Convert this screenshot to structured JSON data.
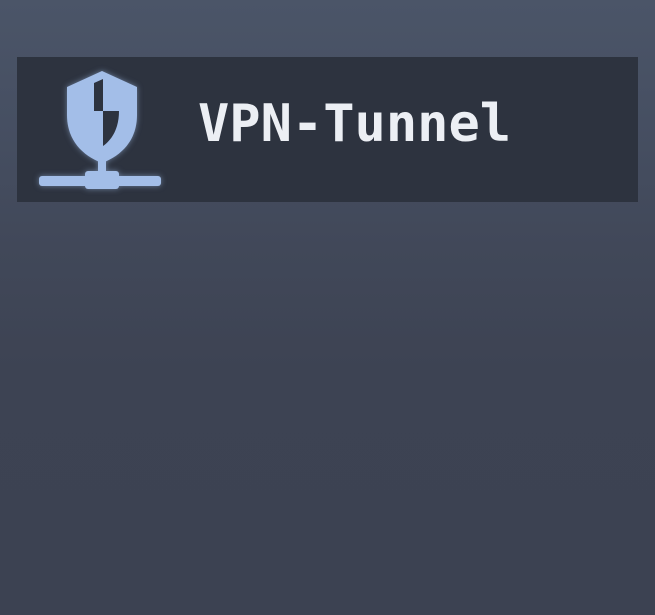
{
  "panel": {
    "title": "VPN-Tunnel",
    "icon": "shield-network-icon"
  },
  "colors": {
    "background_top": "#4b5568",
    "background_bottom": "#3c4252",
    "panel_background": "#2d333f",
    "title_text": "#eceff4",
    "icon_fill": "#a3bee8",
    "icon_dark": "#2d333f"
  }
}
